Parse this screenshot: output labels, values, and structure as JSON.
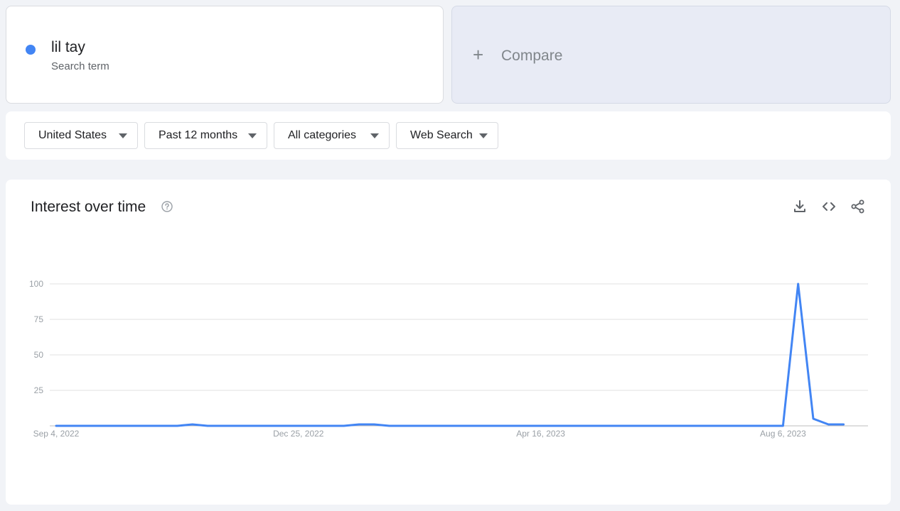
{
  "term": {
    "name": "lil tay",
    "subtitle": "Search term",
    "color": "#4285f4"
  },
  "compare": {
    "label": "Compare",
    "icon": "plus-icon"
  },
  "filters": {
    "region": "United States",
    "time": "Past 12 months",
    "category": "All categories",
    "search_type": "Web Search"
  },
  "chart_section": {
    "title": "Interest over time",
    "icons": [
      "help-icon",
      "download-icon",
      "embed-icon",
      "share-icon"
    ]
  },
  "chart_data": {
    "type": "line",
    "title": "Interest over time",
    "xlabel": "",
    "ylabel": "",
    "ylim": [
      0,
      100
    ],
    "yticks": [
      "100",
      "75",
      "50",
      "25"
    ],
    "xtick_labels": [
      "Sep 4, 2022",
      "Dec 25, 2022",
      "Apr 16, 2023",
      "Aug 6, 2023"
    ],
    "xtick_weeks": [
      0,
      16,
      32,
      48
    ],
    "grid": true,
    "legend": "none",
    "series": [
      {
        "color": "#4285f4",
        "values": [
          0,
          0,
          0,
          0,
          0,
          0,
          0,
          0,
          0,
          1,
          0,
          0,
          0,
          0,
          0,
          0,
          0,
          0,
          0,
          0,
          1,
          1,
          0,
          0,
          0,
          0,
          0,
          0,
          0,
          0,
          0,
          0,
          0,
          0,
          0,
          0,
          0,
          0,
          0,
          0,
          0,
          0,
          0,
          0,
          0,
          0,
          0,
          0,
          0,
          100,
          5,
          1,
          1
        ]
      }
    ]
  }
}
